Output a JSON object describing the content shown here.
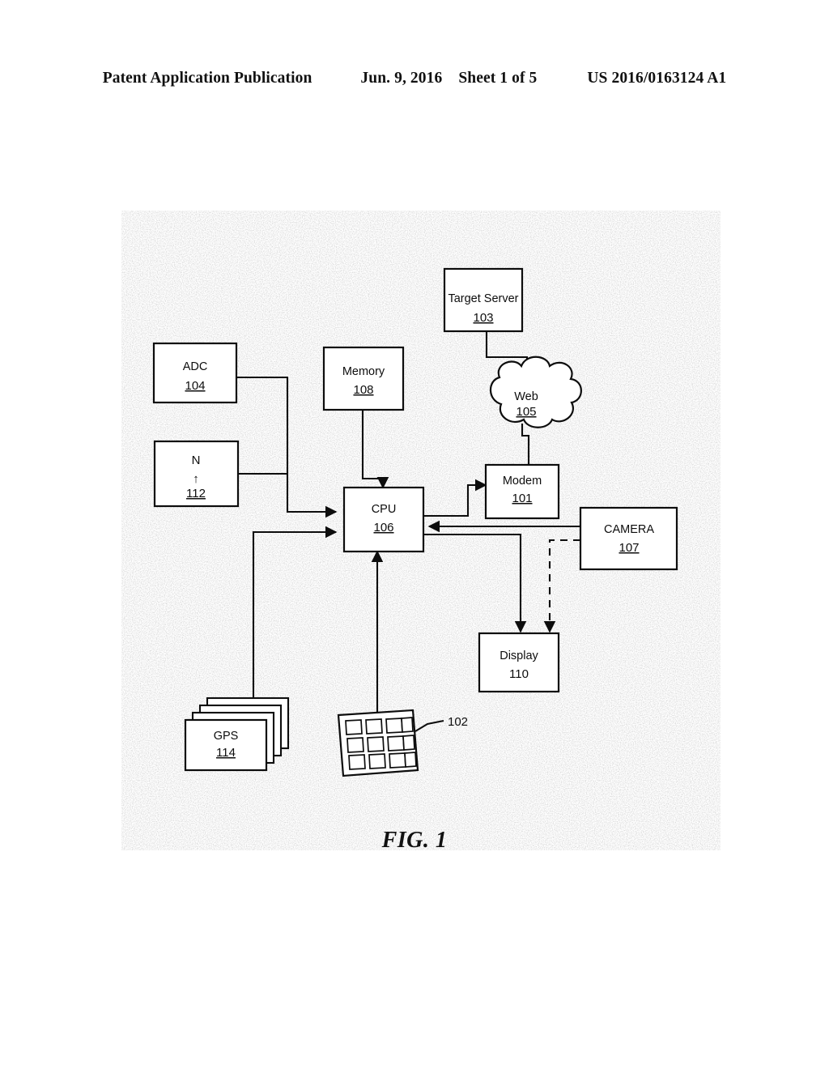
{
  "header": {
    "publication": "Patent Application Publication",
    "date": "Jun. 9, 2016",
    "sheet": "Sheet 1 of 5",
    "number": "US 2016/0163124 A1"
  },
  "figure": {
    "caption": "FIG. 1",
    "nodes": {
      "target_server": {
        "label": "Target Server",
        "num": "103"
      },
      "web": {
        "label": "Web",
        "num": "105"
      },
      "adc": {
        "label": "ADC",
        "num": "104"
      },
      "memory": {
        "label": "Memory",
        "num": "108"
      },
      "compass": {
        "label": "N",
        "arrow": "↑",
        "num": "112"
      },
      "cpu": {
        "label": "CPU",
        "num": "106"
      },
      "modem": {
        "label": "Modem",
        "num": "101"
      },
      "camera": {
        "label": "CAMERA",
        "num": "107"
      },
      "display": {
        "label": "Display",
        "num": "110"
      },
      "gps": {
        "label": "GPS",
        "num": "114"
      },
      "keypad": {
        "label": "",
        "num": "102"
      }
    }
  },
  "colors": {
    "ink": "#0d0d0d",
    "page": "#ffffff"
  }
}
